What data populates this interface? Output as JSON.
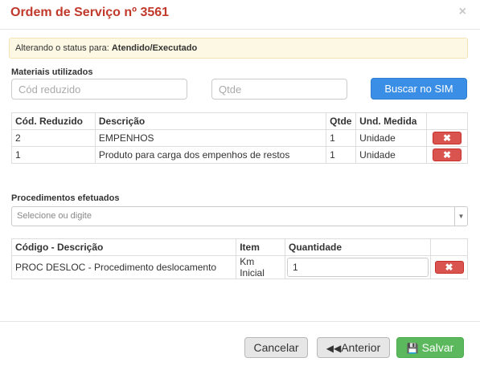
{
  "dialog": {
    "title": "Ordem de Serviço nº 3561",
    "close": "×"
  },
  "alert": {
    "prefix": "Alterando o status para: ",
    "status": "Atendido/Executado"
  },
  "materials": {
    "label": "Materiais utilizados",
    "code_placeholder": "Cód reduzido",
    "qty_placeholder": "Qtde",
    "search_button": "Buscar no SIM",
    "columns": [
      "Cód. Reduzido",
      "Descrição",
      "Qtde",
      "Und. Medida"
    ],
    "rows": [
      {
        "code": "2",
        "description": "EMPENHOS",
        "qty": "1",
        "unit": "Unidade"
      },
      {
        "code": "1",
        "description": "Produto para carga dos empenhos de restos",
        "qty": "1",
        "unit": "Unidade"
      }
    ]
  },
  "procedures": {
    "label": "Procedimentos efetuados",
    "select_placeholder": "Selecione ou digite",
    "columns": [
      "Código - Descrição",
      "Item",
      "Quantidade"
    ],
    "rows": [
      {
        "description": "PROC DESLOC - Procedimento deslocamento",
        "item": "Km Inicial",
        "quantity": "1"
      }
    ]
  },
  "footer": {
    "cancel": "Cancelar",
    "previous": "Anterior",
    "save": "Salvar"
  },
  "colors": {
    "title": "#c0392b",
    "primary": "#3a8ee6",
    "danger": "#d9534f",
    "success": "#5cb85c",
    "alert_bg": "#fcf8e3"
  }
}
